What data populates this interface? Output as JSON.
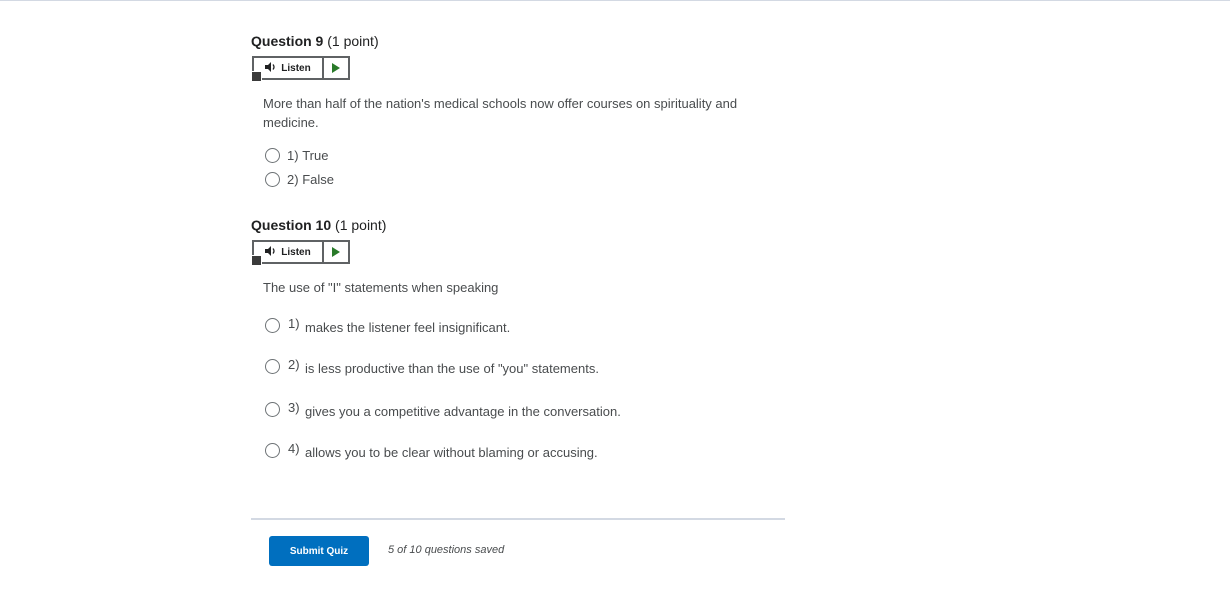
{
  "questions": [
    {
      "number_label": "Question 9",
      "points": "(1 point)",
      "listen_label": "Listen",
      "text": "More than half of the nation's medical schools now offer courses on spirituality and medicine.",
      "options": [
        {
          "num": "1)",
          "text": "True"
        },
        {
          "num": "2)",
          "text": "False"
        }
      ]
    },
    {
      "number_label": "Question 10",
      "points": "(1 point)",
      "listen_label": "Listen",
      "text": "The use of \"I\" statements when speaking",
      "options": [
        {
          "num": "1)",
          "text": "makes the listener feel insignificant."
        },
        {
          "num": "2)",
          "text": "is less productive than the use of \"you\" statements."
        },
        {
          "num": "3)",
          "text": "gives you a competitive advantage in the conversation."
        },
        {
          "num": "4)",
          "text": "allows you to be clear without blaming or accusing."
        }
      ]
    }
  ],
  "footer": {
    "submit_label": "Submit Quiz",
    "saved_status": "5 of 10 questions saved"
  },
  "colors": {
    "primary": "#006fbf",
    "play": "#2a7a2a"
  }
}
